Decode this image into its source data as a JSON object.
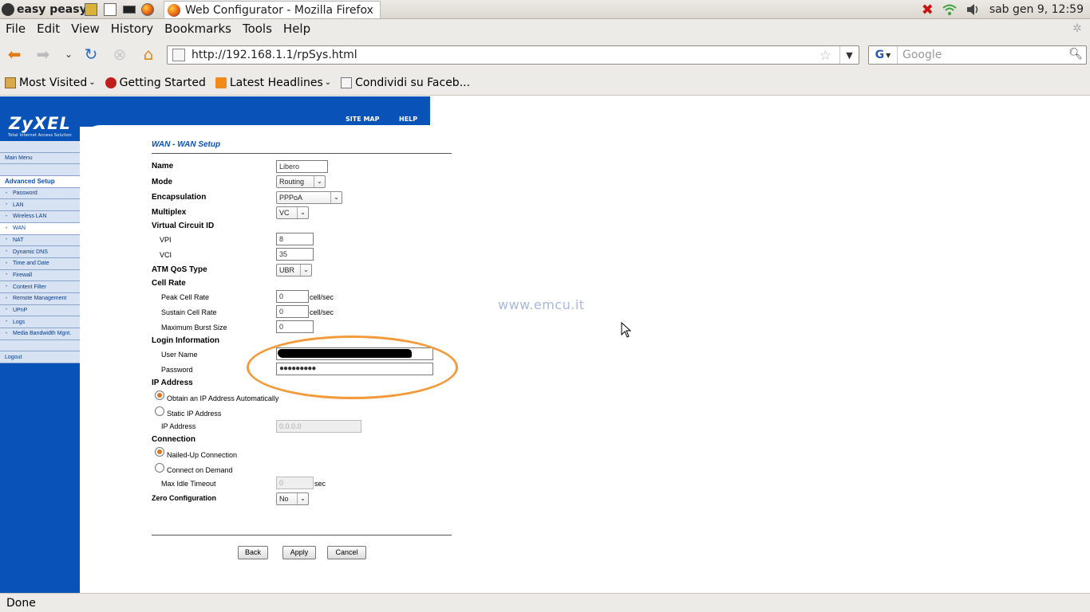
{
  "panel": {
    "distro_label": "easy peasy",
    "window_title": "Web Configurator - Mozilla Firefox",
    "clock": "sab gen  9, 12:59"
  },
  "menubar": {
    "items": [
      "File",
      "Edit",
      "View",
      "History",
      "Bookmarks",
      "Tools",
      "Help"
    ]
  },
  "navbar": {
    "url": "http://192.168.1.1/rpSys.html",
    "search_placeholder": "Google",
    "search_engine_letter": "G"
  },
  "bookmarks": {
    "items": [
      "Most Visited",
      "Getting Started",
      "Latest Headlines",
      "Condividi su Faceb..."
    ]
  },
  "zyxel": {
    "brand": "ZyXEL",
    "tagline": "Total Internet Access Solution",
    "top_links": [
      "SITE MAP",
      "HELP"
    ],
    "menu": {
      "main_menu": "Main Menu",
      "advanced_setup": "Advanced Setup",
      "items": [
        "Password",
        "LAN",
        "Wireless LAN",
        "WAN",
        "NAT",
        "Dynamic DNS",
        "Time and Date",
        "Firewall",
        "Content Filter",
        "Remote Management",
        "UPnP",
        "Logs",
        "Media Bandwidth Mgnt."
      ],
      "logout": "Logout"
    }
  },
  "form": {
    "heading": "WAN - WAN Setup",
    "name_label": "Name",
    "name_value": "Libero",
    "mode_label": "Mode",
    "mode_value": "Routing",
    "encapsulation_label": "Encapsulation",
    "encapsulation_value": "PPPoA",
    "multiplex_label": "Multiplex",
    "multiplex_value": "VC",
    "vcid_label": "Virtual Circuit ID",
    "vpi_label": "VPI",
    "vpi_value": "8",
    "vci_label": "VCI",
    "vci_value": "35",
    "qos_label": "ATM QoS Type",
    "qos_value": "UBR",
    "cell_rate_label": "Cell Rate",
    "peak_label": "Peak Cell Rate",
    "peak_value": "0",
    "sustain_label": "Sustain Cell Rate",
    "sustain_value": "0",
    "burst_label": "Maximum Burst Size",
    "burst_value": "0",
    "cell_unit": "cell/sec",
    "login_label": "Login Information",
    "user_label": "User Name",
    "password_label": "Password",
    "password_value": "●●●●●●●●●",
    "ip_label": "IP Address",
    "obtain_auto_label": "Obtain an IP Address Automatically",
    "static_ip_label": "Static IP Address",
    "ip_address_label": "IP Address",
    "ip_address_value": "0.0.0.0",
    "connection_label": "Connection",
    "nailed_up_label": "Nailed-Up Connection",
    "on_demand_label": "Connect on Demand",
    "idle_label": "Max Idle Timeout",
    "idle_value": "0",
    "idle_unit": "sec",
    "zero_conf_label": "Zero Configuration",
    "zero_conf_value": "No",
    "back": "Back",
    "apply": "Apply",
    "cancel": "Cancel"
  },
  "watermark": "www.emcu.it",
  "status": "Done"
}
